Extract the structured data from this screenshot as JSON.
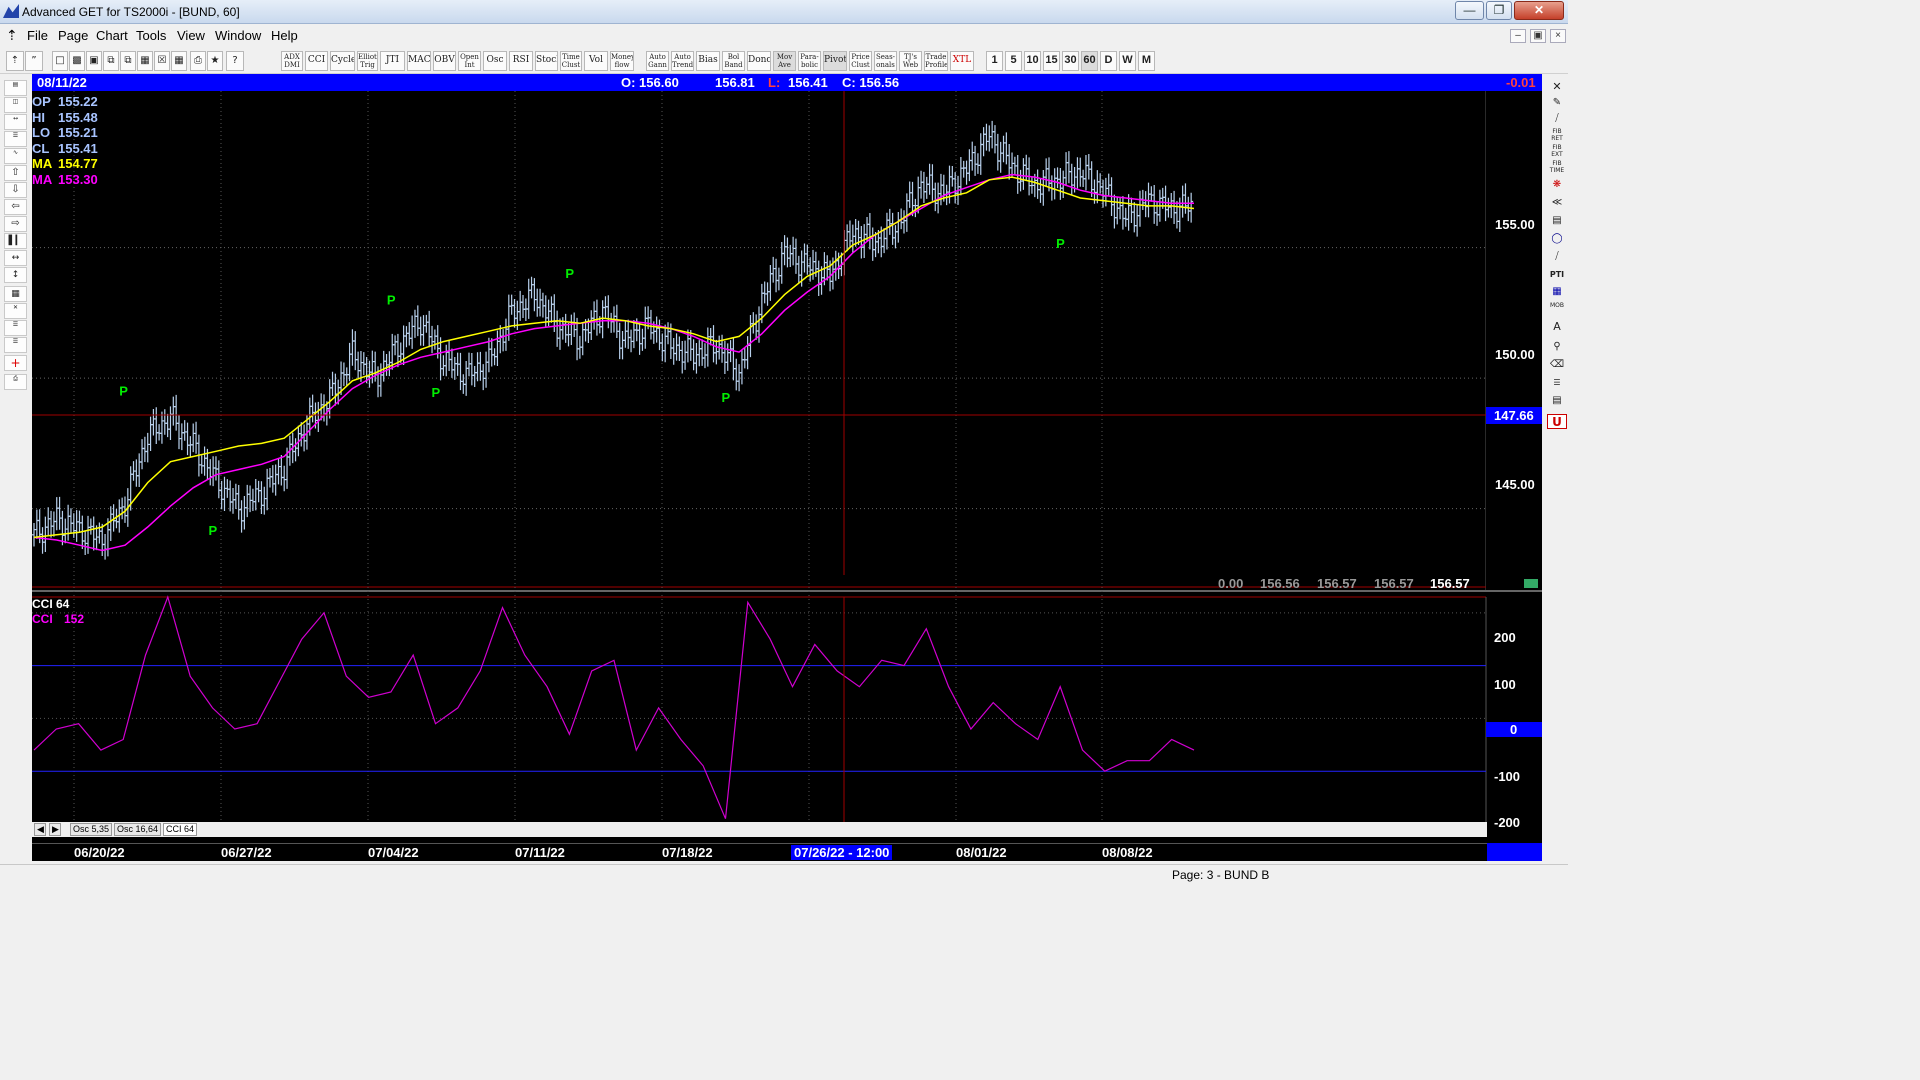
{
  "window": {
    "title": "Advanced GET for TS2000i - [BUND, 60]"
  },
  "menu": [
    "File",
    "Page",
    "Chart",
    "Tools",
    "View",
    "Window",
    "Help"
  ],
  "toolbar": {
    "indicators": [
      {
        "label": "ADX DMI"
      },
      {
        "label": "CCI"
      },
      {
        "label": "Cycles"
      },
      {
        "label": "Elliott Trig"
      },
      {
        "label": "JTI"
      },
      {
        "label": "MACD"
      },
      {
        "label": "OBV"
      },
      {
        "label": "Open Int"
      },
      {
        "label": "Osc"
      },
      {
        "label": "RSI"
      },
      {
        "label": "Stoch"
      },
      {
        "label": "Time Clust"
      },
      {
        "label": "Vol"
      },
      {
        "label": "Money flow"
      },
      {
        "label": "Auto Gann"
      },
      {
        "label": "Auto Trend"
      },
      {
        "label": "Bias"
      },
      {
        "label": "Bol Band"
      },
      {
        "label": "Donch"
      },
      {
        "label": "Mov Ave"
      },
      {
        "label": "Para-bolic"
      },
      {
        "label": "Pivot"
      },
      {
        "label": "Price Clust"
      },
      {
        "label": "Seas-onals"
      },
      {
        "label": "TJ's Web"
      },
      {
        "label": "Trade Profile"
      },
      {
        "label": "XTL"
      }
    ],
    "timeframes": [
      "1",
      "5",
      "10",
      "15",
      "30",
      "60",
      "D",
      "W",
      "M"
    ],
    "selected_timeframe": "60"
  },
  "info_bar": {
    "date": "08/11/22",
    "open": "O: 156.60",
    "high": "156.81",
    "low_label": "L:",
    "low": "156.41",
    "close": "C: 156.56",
    "change": "-0.01"
  },
  "legend": {
    "op": {
      "label": "OP",
      "value": "155.22"
    },
    "hi": {
      "label": "HI",
      "value": "155.48"
    },
    "lo": {
      "label": "LO",
      "value": "155.21"
    },
    "cl": {
      "label": "CL",
      "value": "155.41"
    },
    "ma1": {
      "label": "MA",
      "value": "154.77"
    },
    "ma2": {
      "label": "MA",
      "value": "153.30"
    }
  },
  "price_axis": {
    "labels": [
      "155.00",
      "150.00",
      "145.00"
    ],
    "crosshair_value": "147.66"
  },
  "bottom_values": [
    "0.00",
    "156.56",
    "156.57",
    "156.57",
    "156.57"
  ],
  "cci": {
    "title": "CCI 64",
    "label": "CCI",
    "value": "152",
    "ticks": [
      "200",
      "100",
      "0",
      "-100",
      "-200"
    ]
  },
  "tabs": [
    "Osc 5,35",
    "Osc 16,64",
    "CCI 64"
  ],
  "dates": [
    "06/20/22",
    "06/27/22",
    "07/04/22",
    "07/11/22",
    "07/18/22",
    "07/26/22 - 12:00",
    "08/01/22",
    "08/08/22"
  ],
  "status": "Page: 3 - BUND B",
  "pivot_label": "P",
  "colors": {
    "price": "#b8d0ec",
    "ma_fast": "#ffff00",
    "ma_slow": "#ff00ff",
    "cci": "#d000d0",
    "pivot": "#00ee00",
    "crosshair": "#a00000"
  },
  "chart_data": {
    "type": "line",
    "title": "",
    "x_labels": [
      "06/20/22",
      "06/27/22",
      "07/04/22",
      "07/11/22",
      "07/18/22",
      "07/26/22",
      "08/01/22",
      "08/08/22"
    ],
    "ylim": [
      142,
      161
    ],
    "series": [
      {
        "name": "",
        "values": [
          144.0,
          144.6,
          144.2,
          143.8,
          145.2,
          147.8,
          148.5,
          147.4,
          146.1,
          145.0,
          145.6,
          146.6,
          148.3,
          149.2,
          150.9,
          150.0,
          151.2,
          152.2,
          150.7,
          150.1,
          150.6,
          152.5,
          153.2,
          152.0,
          151.5,
          152.6,
          151.4,
          152.0,
          151.2,
          150.9,
          151.3,
          150.2,
          153.0,
          154.8,
          154.3,
          153.9,
          155.6,
          155.2,
          155.9,
          157.4,
          157.1,
          158.0,
          159.3,
          158.1,
          157.4,
          157.6,
          157.9,
          157.2,
          156.1,
          156.8,
          156.5,
          156.6
        ]
      },
      {
        "name": "MA",
        "values": [
          143.9,
          144.0,
          144.1,
          144.3,
          144.9,
          146.0,
          146.8,
          147.0,
          147.2,
          147.4,
          147.5,
          147.7,
          148.4,
          149.1,
          149.9,
          150.2,
          150.6,
          151.1,
          151.4,
          151.6,
          151.8,
          152.0,
          152.1,
          152.2,
          152.1,
          152.3,
          152.2,
          152.0,
          151.9,
          151.7,
          151.4,
          151.6,
          152.3,
          153.2,
          153.9,
          154.3,
          155.1,
          155.5,
          156.0,
          156.6,
          156.9,
          157.1,
          157.6,
          157.7,
          157.5,
          157.2,
          156.9,
          156.8,
          156.7,
          156.6,
          156.6,
          156.5
        ]
      },
      {
        "name": "MA",
        "values": [
          143.9,
          143.8,
          143.6,
          143.4,
          143.6,
          144.3,
          145.1,
          145.8,
          146.3,
          146.5,
          146.7,
          147.0,
          147.9,
          148.8,
          149.6,
          150.1,
          150.5,
          150.8,
          151.0,
          151.2,
          151.4,
          151.7,
          151.9,
          152.0,
          152.1,
          152.2,
          152.2,
          152.1,
          151.9,
          151.6,
          151.2,
          151.0,
          151.7,
          152.6,
          153.3,
          153.9,
          154.8,
          155.5,
          156.0,
          156.5,
          157.0,
          157.3,
          157.6,
          157.8,
          157.7,
          157.5,
          157.2,
          157.0,
          156.9,
          156.8,
          156.7,
          156.7
        ]
      }
    ],
    "cci_series": {
      "name": "CCI 64",
      "ylim": [
        -200,
        230
      ],
      "values": [
        -60,
        -20,
        -10,
        -60,
        -40,
        120,
        230,
        80,
        20,
        -20,
        -10,
        70,
        150,
        200,
        80,
        40,
        50,
        120,
        -10,
        20,
        90,
        210,
        120,
        60,
        -30,
        90,
        110,
        -60,
        20,
        -40,
        -90,
        -190,
        220,
        150,
        60,
        140,
        90,
        60,
        110,
        100,
        170,
        60,
        -20,
        30,
        -10,
        -40,
        60,
        -60,
        -100,
        -80,
        -80,
        -40,
        -60
      ]
    },
    "pivots": [
      {
        "x": "06/24/22",
        "value": 149.1,
        "type": "high"
      },
      {
        "x": "06/28/22",
        "value": 144.6,
        "type": "low"
      },
      {
        "x": "07/06/22",
        "value": 152.6,
        "type": "high"
      },
      {
        "x": "07/08/22",
        "value": 149.9,
        "type": "low"
      },
      {
        "x": "07/14/22",
        "value": 153.6,
        "type": "high"
      },
      {
        "x": "07/21/22",
        "value": 149.7,
        "type": "low"
      },
      {
        "x": "08/05/22",
        "value": 155.6,
        "type": "low"
      }
    ]
  }
}
